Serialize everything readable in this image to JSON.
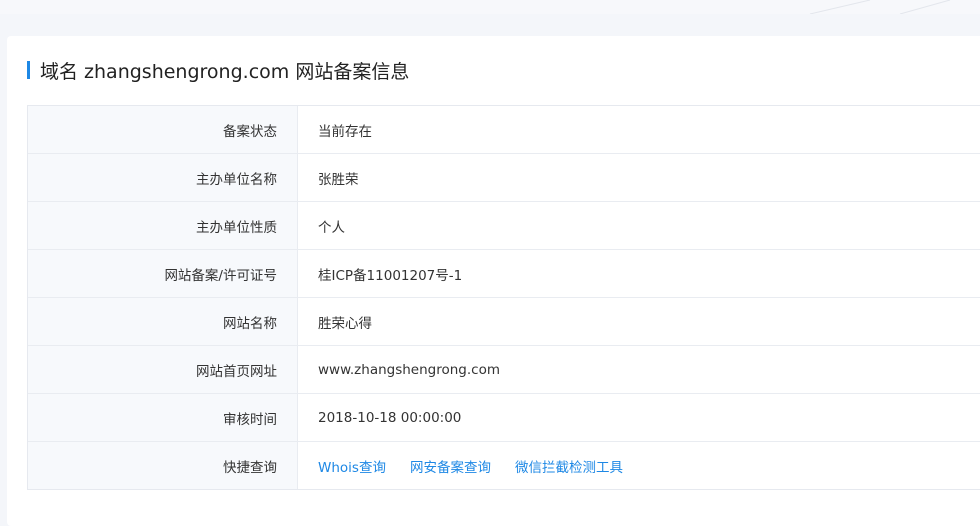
{
  "heading": {
    "title": "域名 zhangshengrong.com 网站备案信息"
  },
  "rows": [
    {
      "label": "备案状态",
      "value": "当前存在"
    },
    {
      "label": "主办单位名称",
      "value": "张胜荣"
    },
    {
      "label": "主办单位性质",
      "value": "个人"
    },
    {
      "label": "网站备案/许可证号",
      "value": "桂ICP备11001207号-1"
    },
    {
      "label": "网站名称",
      "value": "胜荣心得"
    },
    {
      "label": "网站首页网址",
      "value": "www.zhangshengrong.com"
    },
    {
      "label": "审核时间",
      "value": "2018-10-18 00:00:00"
    }
  ],
  "quick": {
    "label": "快捷查询",
    "links": [
      "Whois查询",
      "网安备案查询",
      "微信拦截检测工具"
    ]
  },
  "colors": {
    "accent": "#1e88e5",
    "label_bg": "#f7f9fc",
    "page_bg": "#f4f6fa"
  }
}
